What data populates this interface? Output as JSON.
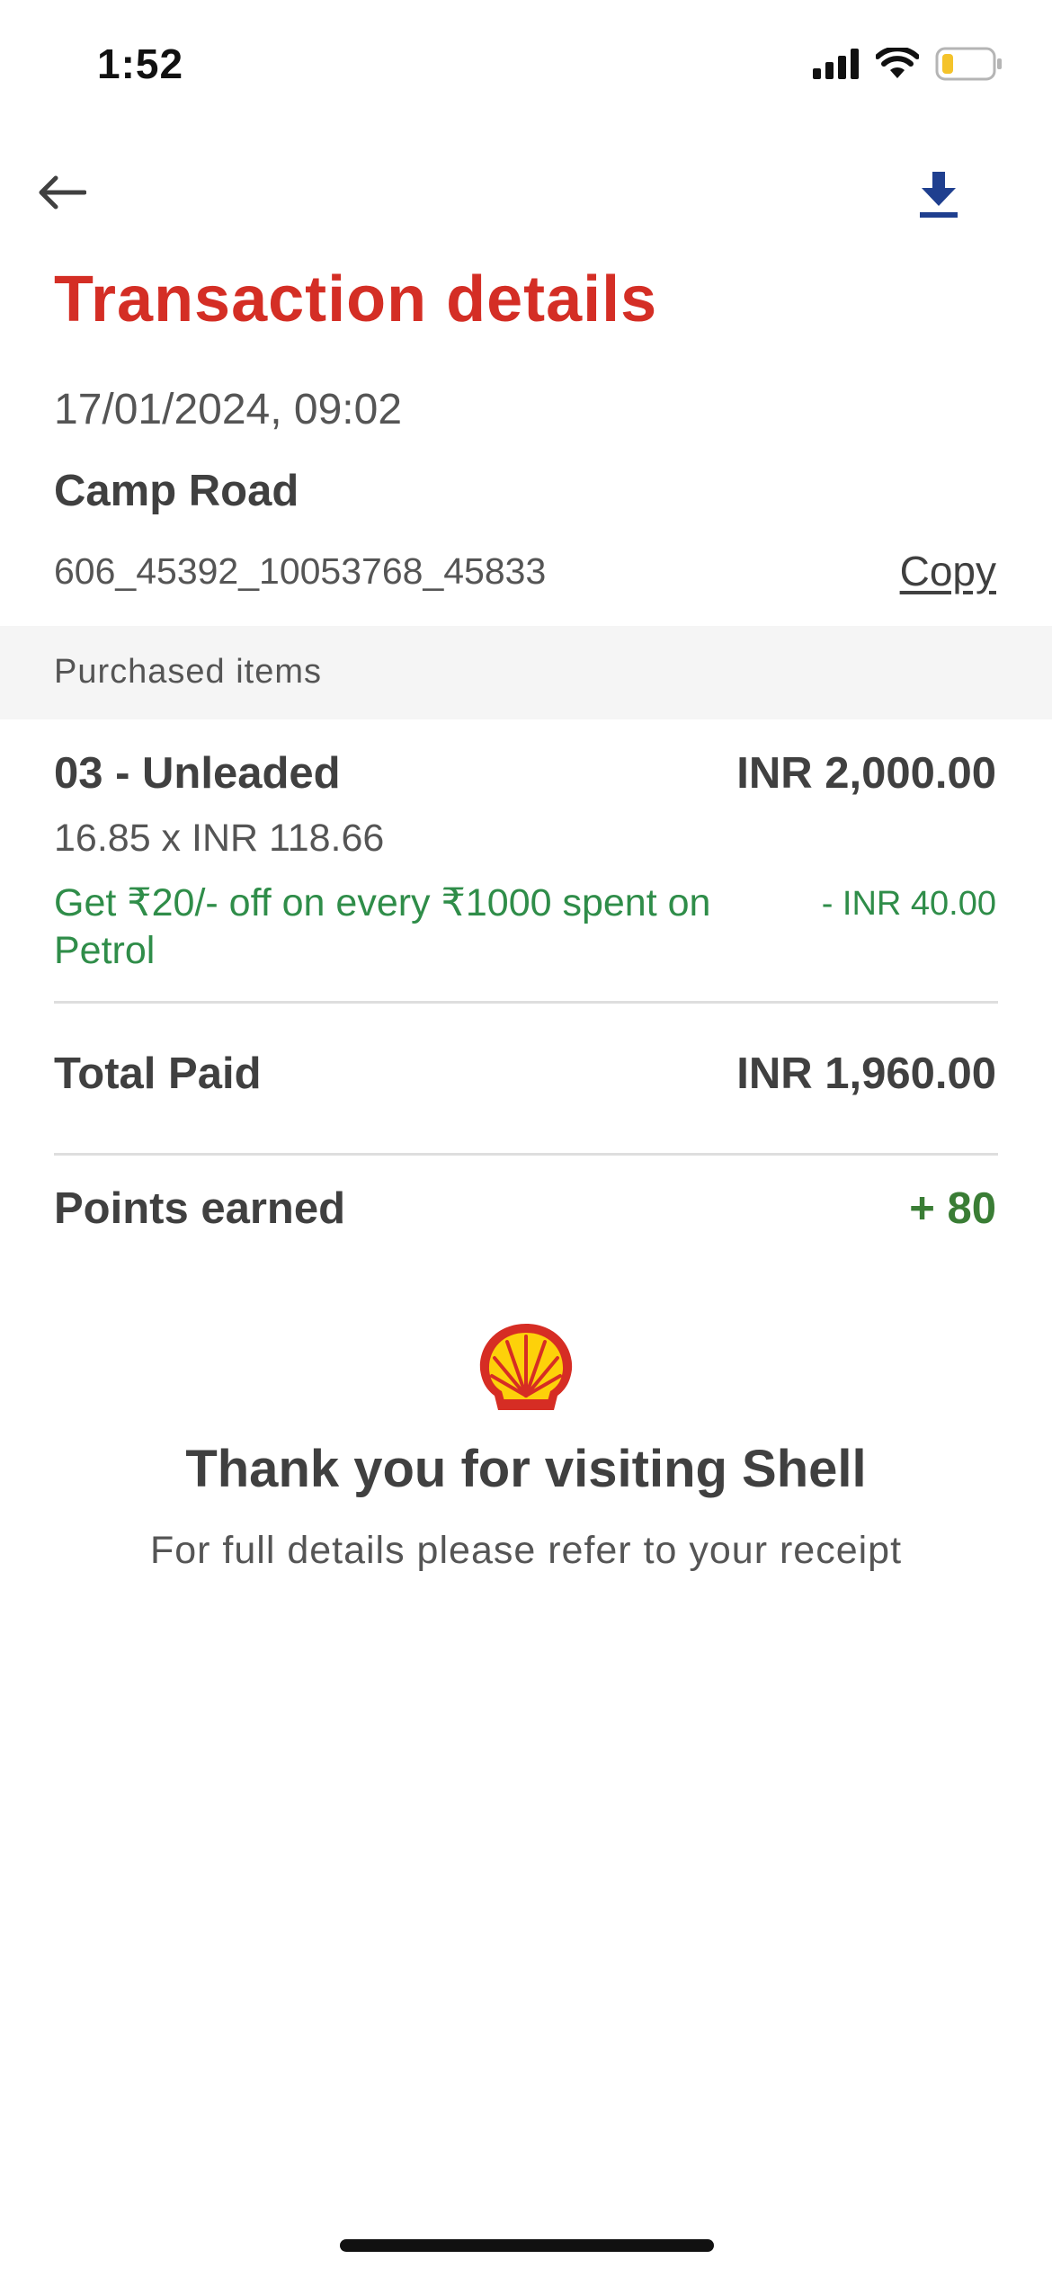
{
  "status_bar": {
    "time": "1:52",
    "icons": [
      "cellular-signal-icon",
      "wifi-icon",
      "battery-low-icon"
    ]
  },
  "nav": {
    "back_icon": "arrow-left-icon",
    "download_icon": "download-icon"
  },
  "header": {
    "title": "Transaction details"
  },
  "transaction": {
    "datetime": "17/01/2024, 09:02",
    "station": "Camp Road",
    "id": "606_45392_10053768_45833",
    "copy_label": "Copy"
  },
  "purchased": {
    "section_label": "Purchased items",
    "items": [
      {
        "name": "03 - Unleaded",
        "amount": "INR 2,000.00",
        "quantity_line": "16.85 x INR 118.66",
        "promo": "Get ₹20/- off on every ₹1000 spent on Petrol",
        "promo_amount": "- INR 40.00"
      }
    ]
  },
  "summary": {
    "total_label": "Total Paid",
    "total_value": "INR 1,960.00",
    "points_label": "Points earned",
    "points_value": "+ 80"
  },
  "footer": {
    "logo_icon": "shell-logo-icon",
    "thanks": "Thank you for visiting Shell",
    "subtext": "For full details please refer to your receipt"
  },
  "colors": {
    "title": "#d42e25",
    "promo_green": "#2f8d49",
    "points_green": "#3a7d35",
    "download_blue": "#1f3f8f",
    "section_bg": "#f5f5f5"
  }
}
